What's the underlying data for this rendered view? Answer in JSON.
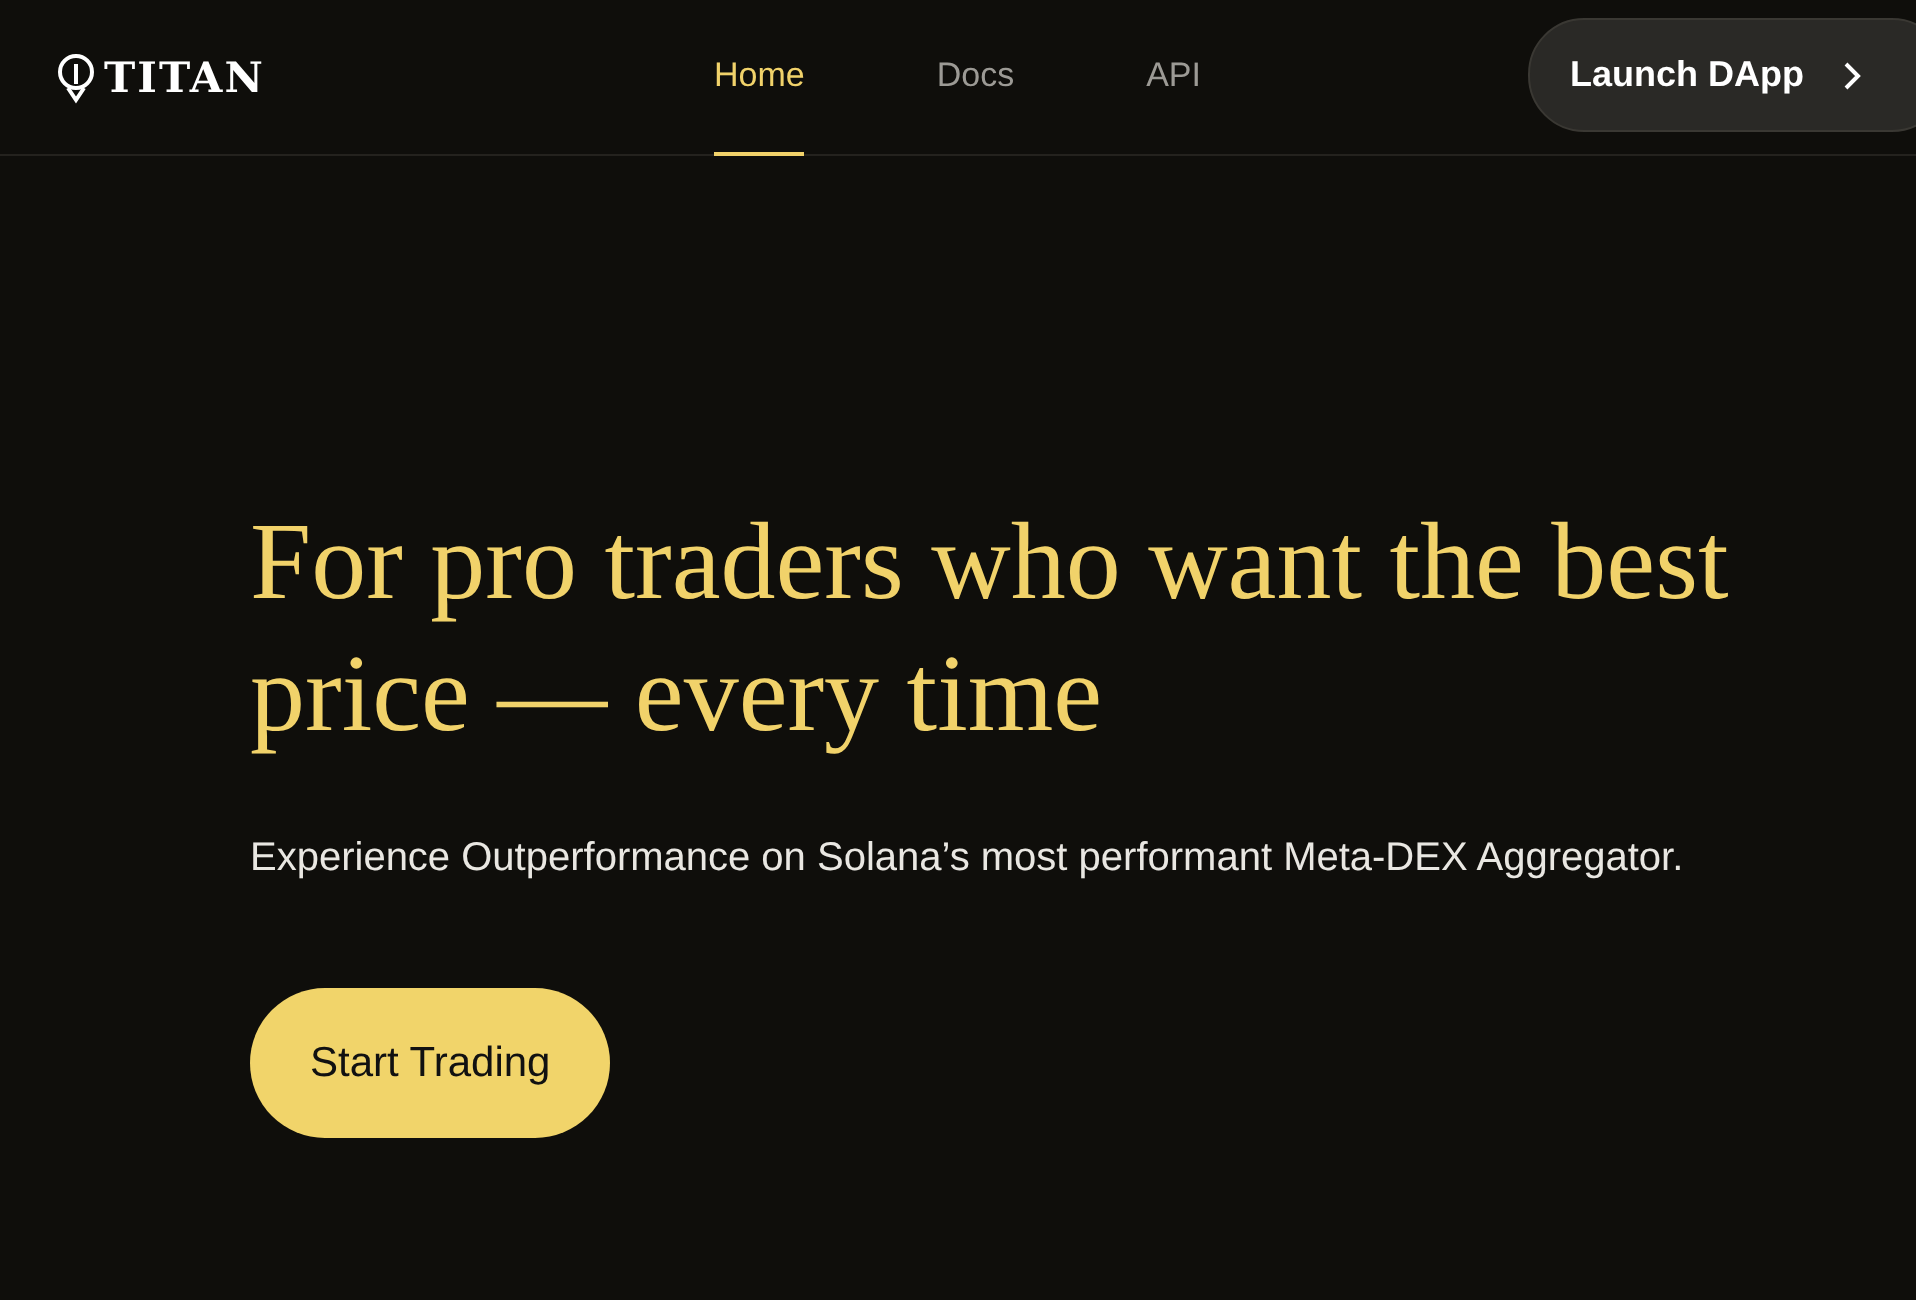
{
  "brand": "TITAN",
  "nav": [
    {
      "label": "Home",
      "selected": true
    },
    {
      "label": "Docs",
      "selected": false
    },
    {
      "label": "API",
      "selected": false
    }
  ],
  "launch_button": {
    "label": "Launch DApp"
  },
  "hero": {
    "title": "For pro traders who want the best price — every time",
    "subtitle": "Experience Outperformance on Solana’s most performant Meta-DEX Aggregator.",
    "cta": "Start Trading"
  }
}
